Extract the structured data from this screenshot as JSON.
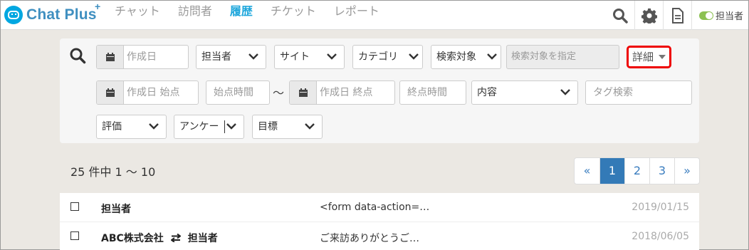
{
  "app": {
    "logo_text": "Chat Plus",
    "logo_plus": "+"
  },
  "nav": {
    "items": [
      {
        "label": "チャット"
      },
      {
        "label": "訪問者"
      },
      {
        "label": "履歴"
      },
      {
        "label": "チケット"
      },
      {
        "label": "レポート"
      }
    ],
    "active_index": 2
  },
  "header_right": {
    "icons": [
      "search-icon",
      "gear-icon",
      "document-icon"
    ],
    "status_label": "担当者",
    "status_on": true,
    "toggle_color": "#8cc152"
  },
  "filters": {
    "created_date_placeholder": "作成日",
    "assignee_select": "担当者",
    "site_select": "サイト",
    "category_select": "カテゴリ",
    "search_target_select": "検索対象",
    "search_target_placeholder": "検索対象を指定",
    "detail_button": "詳細",
    "created_start_placeholder": "作成日 始点",
    "start_time_placeholder": "始点時間",
    "range_separator": "〜",
    "created_end_placeholder": "作成日 終点",
    "end_time_placeholder": "終点時間",
    "content_select": "内容",
    "tag_search_placeholder": "タグ検索",
    "rating_select": "評価",
    "survey_select": "アンケー",
    "goal_select": "目標"
  },
  "results": {
    "summary": "25 件中 1 〜 10",
    "pagination": [
      "«",
      "1",
      "2",
      "3",
      "»"
    ],
    "current_page": 1,
    "rows": [
      {
        "who_left": "担当者",
        "who_right": "",
        "message": "<form data-action=…",
        "date": "2019/01/15"
      },
      {
        "who_left": "ABC株式会社",
        "who_right": "担当者",
        "message": "ご来訪ありがとうご…",
        "date": "2018/06/05"
      }
    ]
  },
  "colors": {
    "accent": "#1fa7dc",
    "brand": "#3f8fc0",
    "highlight_border": "#e00000",
    "page_active": "#337ab7"
  }
}
